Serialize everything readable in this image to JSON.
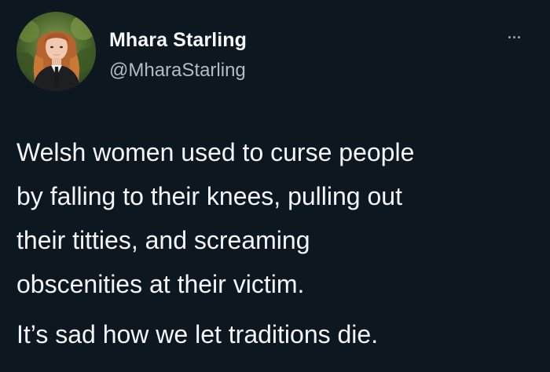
{
  "author": {
    "display_name": "Mhara Starling",
    "handle": "@MharaStarling",
    "avatar": "profile-photo"
  },
  "more_icon": "more-horizontal-icon",
  "tweet": {
    "lines": [
      "Welsh women used to curse people",
      "by falling to their knees, pulling out",
      "their titties, and screaming",
      "obscenities at their victim."
    ],
    "closing": "It’s sad how we let traditions die."
  },
  "colors": {
    "background": "#0d1720",
    "text": "#f3f5f7",
    "secondary_text": "#b3bcc4"
  }
}
